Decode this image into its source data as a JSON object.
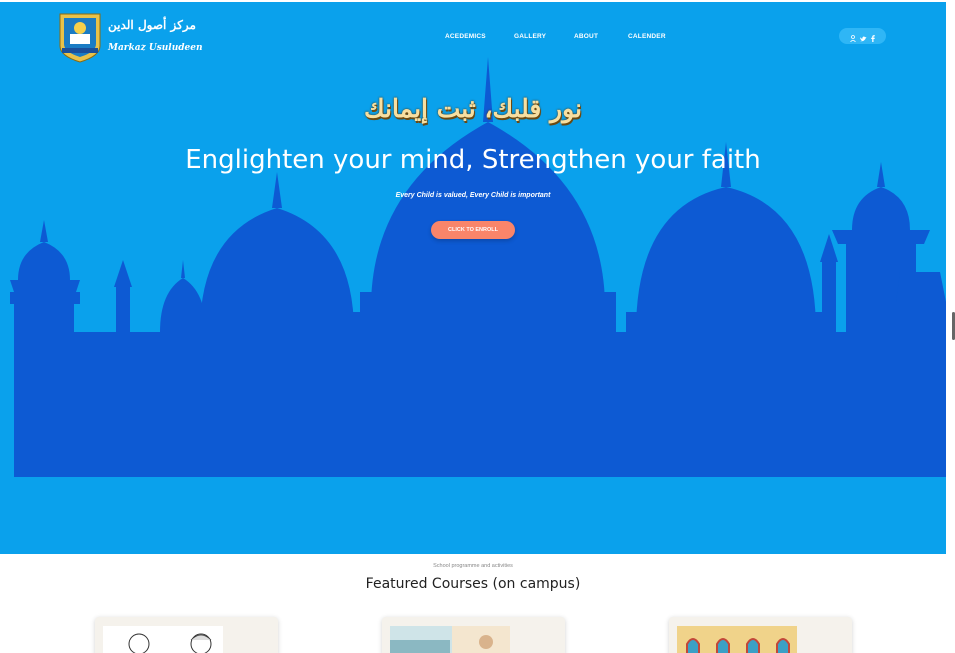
{
  "brand": {
    "arabic_name": "مركز أصول الدين",
    "english_name": "Markaz Usuludeen"
  },
  "nav": {
    "items": [
      {
        "label": "ACEDEMICS"
      },
      {
        "label": "GALLERY"
      },
      {
        "label": "ABOUT"
      },
      {
        "label": "CALENDER"
      }
    ]
  },
  "social": {
    "icons": [
      "user-icon",
      "twitter-icon",
      "facebook-icon"
    ]
  },
  "hero": {
    "arabic_headline": "نور قلبك، ثبت إيمانك",
    "headline": "Englighten your mind, Strengthen your faith",
    "tagline": "Every Child is valued, Every Child is important",
    "cta_label": "CLICK TO ENROLL",
    "background_color": "#0aa1ec",
    "silhouette_color": "#0d5ad3"
  },
  "featured": {
    "subtitle": "School programme and activities",
    "title": "Featured Courses (on campus)"
  }
}
